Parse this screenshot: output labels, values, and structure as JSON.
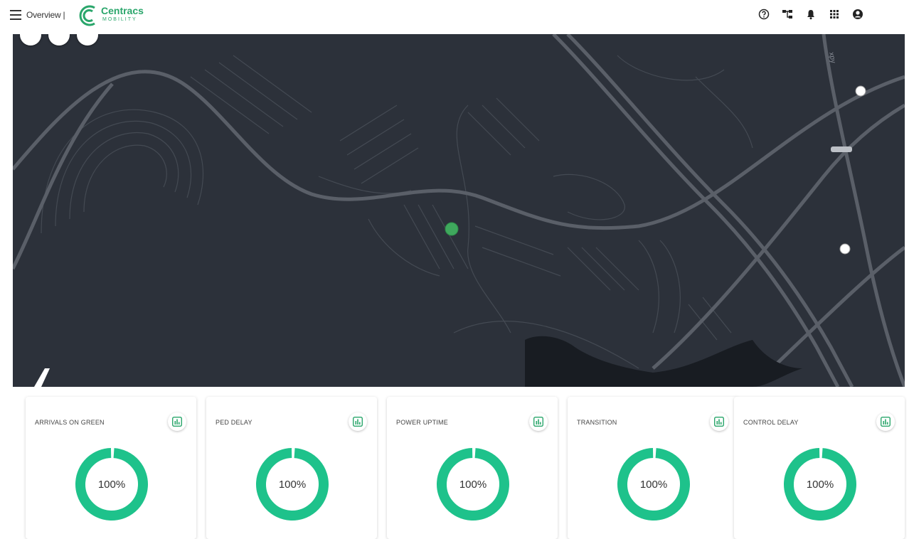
{
  "header": {
    "page_title": "Overview |",
    "logo_name": "Centracs",
    "logo_sub": "MOBILITY",
    "icons": [
      "help-icon",
      "network-icon",
      "notification-bell-icon",
      "apps-grid-icon",
      "user-account-icon"
    ]
  },
  "map": {
    "background_color": "#2c313a",
    "road_color": "#4a4f58",
    "marker_color": "#3fa85d",
    "road_label": "xpy"
  },
  "cards": [
    {
      "title": "ARRIVALS ON GREEN",
      "value": "100%",
      "progress": 1.0
    },
    {
      "title": "PED DELAY",
      "value": "100%",
      "progress": 1.0
    },
    {
      "title": "POWER UPTIME",
      "value": "100%",
      "progress": 1.0
    },
    {
      "title": "TRANSITION",
      "value": "100%",
      "progress": 1.0
    },
    {
      "title": "CONTROL DELAY",
      "value": "100%",
      "progress": 1.0
    }
  ],
  "colors": {
    "accent": "#1ec28b",
    "brand": "#2aa66b"
  }
}
